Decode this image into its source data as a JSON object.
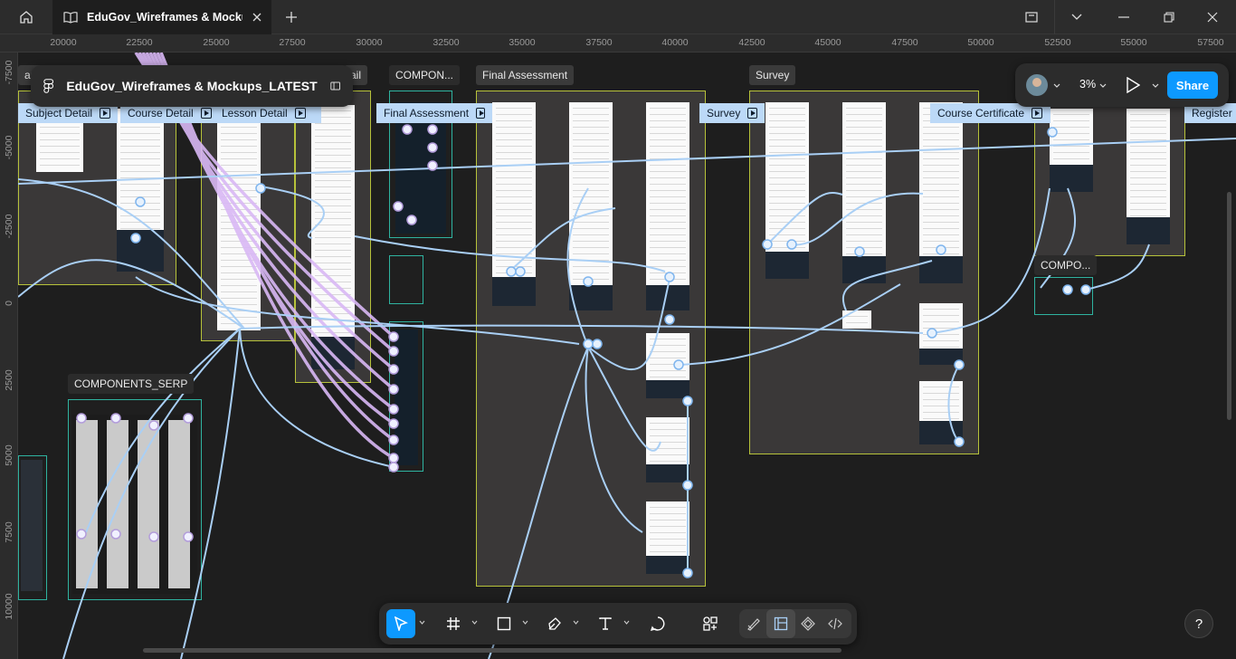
{
  "titlebar": {
    "tab_title": "EduGov_Wireframes & Mockups_LATEST",
    "icons": [
      "home-icon",
      "book-icon",
      "close-icon",
      "plus-icon",
      "layout-icon",
      "chevron-down-icon",
      "minimize-icon",
      "restore-icon",
      "close-window-icon"
    ]
  },
  "ruler": {
    "x_ticks": [
      "20000",
      "22500",
      "25000",
      "27500",
      "30000",
      "32500",
      "35000",
      "37500",
      "40000",
      "42500",
      "45000",
      "47500",
      "50000",
      "52500",
      "55000",
      "57500"
    ],
    "y_ticks": [
      "-7500",
      "-5000",
      "-2500",
      "0",
      "2500",
      "5000",
      "7500",
      "10000"
    ]
  },
  "file_card": {
    "title": "EduGov_Wireframes & Mockups_LATEST"
  },
  "right_panel": {
    "zoom": "3%",
    "share_label": "Share"
  },
  "canvas": {
    "section_labels": [
      "arc",
      "ail",
      "COMPON...",
      "Final Assessment",
      "Survey",
      "COMPONENTS_SERP",
      "COMPO..."
    ],
    "frame_labels": [
      "Subject Detail",
      "Course Detail",
      "Lesson Detail",
      "Final Assessment",
      "Survey",
      "Course Certificate",
      "Register"
    ]
  },
  "toolbar": {
    "tools": [
      "move-tool",
      "frame-tool",
      "rectangle-tool",
      "pen-tool",
      "text-tool",
      "comment-tool",
      "actions-tool"
    ],
    "modes": [
      "draw-mode",
      "design-mode",
      "dev-components-mode",
      "dev-mode"
    ]
  },
  "help_label": "?",
  "colors": {
    "accent": "#0d99ff",
    "section_border": "#b7c23a",
    "teal_border": "#2fb3a0",
    "connector": "#a9cff5",
    "flow_purple": "#d9b8f5",
    "frame_label_bg": "#bcd9f7"
  }
}
